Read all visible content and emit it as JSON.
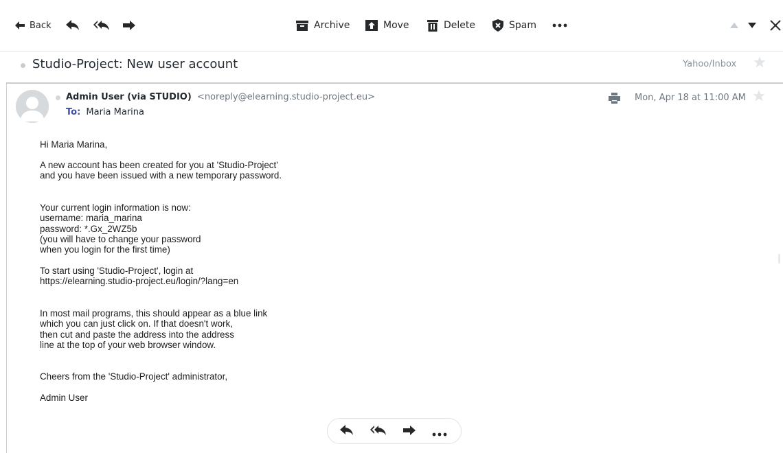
{
  "toolbar": {
    "back_label": "Back",
    "archive_label": "Archive",
    "move_label": "Move",
    "delete_label": "Delete",
    "spam_label": "Spam"
  },
  "message": {
    "subject": "Studio-Project: New user account",
    "folder": "Yahoo/Inbox",
    "sender_name": "Admin User (via STUDIO)",
    "sender_email": "<noreply@elearning.studio-project.eu>",
    "to_label": "To:",
    "to_name": "Maria Marina",
    "date": "Mon, Apr 18 at 11:00 AM",
    "body": {
      "greeting": "Hi Maria Marina,",
      "p2": [
        "A new account has been created for you at 'Studio-Project'",
        "and you have been issued with a new temporary password."
      ],
      "p3": [
        "Your current login information is now:",
        "username: maria_marina",
        "password: *.Gx_2WZ5b",
        "(you will have to change your password",
        "when you login for the first time)"
      ],
      "p4": [
        "To start using 'Studio-Project', login at",
        "https://elearning.studio-project.eu/login/?lang=en"
      ],
      "p5": [
        "In most mail programs, this should appear as a blue link",
        "which you can just click on. If that doesn't work,",
        "then cut and paste the address into the address",
        "line at the top of your web browser window."
      ],
      "closing": "Cheers from the 'Studio-Project' administrator,",
      "signature": "Admin User"
    }
  },
  "colors": {
    "toolbar_icon": "#26282a",
    "muted_icon": "#c7cdd2",
    "to_label": "#3f4fa8",
    "border": "#c9ced3"
  }
}
